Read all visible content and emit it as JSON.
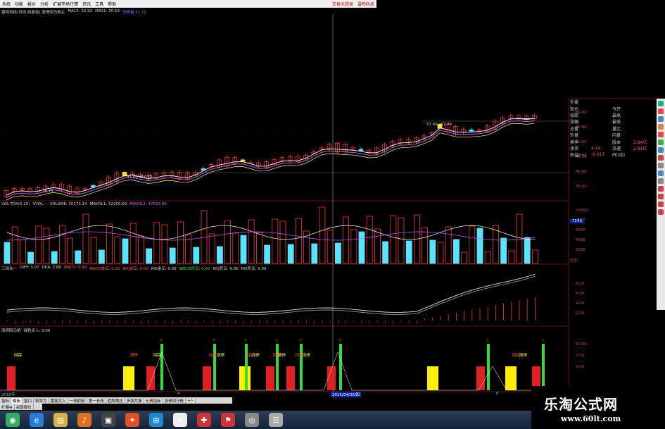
{
  "menubar": {
    "items": [
      "系统",
      "功能",
      "报价",
      "分析",
      "扩展市场行情",
      "资讯",
      "工具",
      "帮助"
    ],
    "right": [
      "交易未登录",
      "雷鸣科技"
    ]
  },
  "price_legend": {
    "title": "雷鸣科技(日线 前复权) 涨停回马枪主",
    "ma1": "MA13: 52.93",
    "ma2": "MA21: 50.53",
    "ma3": "涨跌幅 51.72"
  },
  "price_labels": {
    "high_note": "57.60→57.74",
    "mid_note": "41.80→42.08",
    "low_note": "35.75"
  },
  "price_axis": [
    "60.00",
    "55.00",
    "50.00",
    "45.00",
    "40.00",
    "35.00"
  ],
  "vol_legend": {
    "a": "VOL-TDX(5,20)",
    "b": "VVOL: -",
    "c": "VOLUME: 35173.14",
    "d": "MAVOL1: 52200.00",
    "e": "MAVOL2: 47532.80"
  },
  "vol_axis": [
    "10000",
    "8000",
    "6000",
    "4000",
    "2000"
  ],
  "vol_marker": "7143",
  "vol_unit": "百手",
  "macd_legend": {
    "a": "三线合一",
    "b": "DIFF: 3.07",
    "c": "DEA: 2.85",
    "d": "MACD: 0.43",
    "e": "MACD金叉: 0.00",
    "f": "KDJ金叉: 0.00",
    "g": "RSI金叉: 0.00",
    "h": "WACD死叉: 0.00",
    "i": "KDJ死叉: 0.00",
    "j": "RSI死叉: 0.00"
  },
  "macd_axis": [
    "8.00",
    "6.00",
    "4.00",
    "2.00"
  ],
  "signal_legend": {
    "a": "涨停回马枪",
    "b": "绿色买入: 0.00"
  },
  "signal_axis": [
    "10.00",
    "7.50",
    "5.00"
  ],
  "signal_labels": [
    "回踩",
    "涨停",
    "回踩",
    "回踩",
    "涨停",
    "回踩",
    "涨停",
    "回踩",
    "涨停",
    "回踩",
    "涨停",
    "回踩",
    "涨停"
  ],
  "date_bar": {
    "left": "2015年",
    "mark": "4",
    "center": "2015/04/30/四",
    "right": "8"
  },
  "tabs": [
    "指标",
    "模板",
    "窗口",
    "斜率为",
    "雷霆买入",
    "一线射箭",
    "第一长线",
    "趋势跟庄",
    "多强共振",
    "七线指标",
    "涨停回马枪",
    "+/-"
  ],
  "tabs_bottom": [
    "扩展⊕",
    "关联报价"
  ],
  "side_info": [
    {
      "k": "外盘",
      "v": "",
      "k2": "",
      "v2": ""
    },
    {
      "k": "现价",
      "v": "",
      "k2": "今开",
      "v2": ""
    },
    {
      "k": "涨跌",
      "v": "",
      "k2": "最高",
      "v2": ""
    },
    {
      "k": "涨幅",
      "v": "",
      "k2": "最低",
      "v2": ""
    },
    {
      "k": "总量",
      "v": "",
      "k2": "量比",
      "v2": ""
    },
    {
      "k": "外盘",
      "v": "",
      "k2": "内盘",
      "v2": ""
    },
    {
      "k": "换手",
      "v": "",
      "k2": "股本",
      "v2": "2.84亿"
    },
    {
      "k": "净资",
      "v": "4.14",
      "k2": "流通",
      "v2": "2.81亿"
    },
    {
      "k": "收益(一)",
      "v": "-0.017",
      "k2": "PE(动)",
      "v2": ""
    }
  ],
  "watermark": {
    "line1": "乐淘公式网",
    "line2": "www.60lt.com"
  },
  "taskbar_icons": [
    "start-icon",
    "ie-icon",
    "explorer-icon",
    "media-icon",
    "game-icon",
    "firefox-icon",
    "app-icon",
    "k-icon",
    "finance-icon",
    "flag-icon",
    "chat-icon",
    "tool-icon"
  ],
  "colors": {
    "up": "#ff3333",
    "down": "#55e5ff",
    "signal_red": "#e02020",
    "signal_yellow": "#ffee00",
    "signal_green": "#33dd33",
    "line_white": "#ffffff",
    "line_purple": "#cc66ff",
    "grid": "#661111"
  }
}
